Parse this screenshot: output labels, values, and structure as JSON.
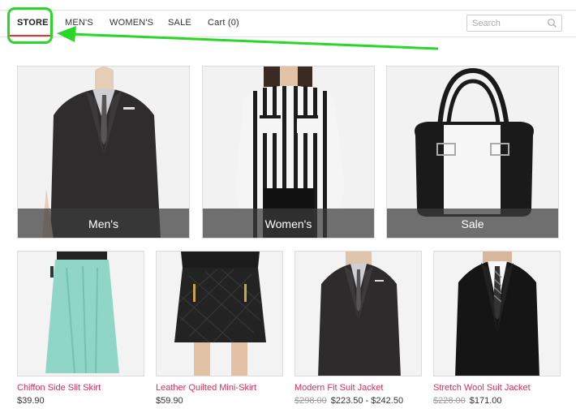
{
  "nav": {
    "items": [
      {
        "label": "STORE",
        "active": true
      },
      {
        "label": "MEN'S"
      },
      {
        "label": "WOMEN'S"
      },
      {
        "label": "SALE"
      },
      {
        "label": "Cart (0)"
      }
    ],
    "search_placeholder": "Search",
    "search_icon": "magnifier-icon"
  },
  "categories": [
    {
      "label": "Men's"
    },
    {
      "label": "Women's"
    },
    {
      "label": "Sale"
    }
  ],
  "products": [
    {
      "name": "Chiffon Side Slit Skirt",
      "price": "$39.90"
    },
    {
      "name": "Leather Quilted Mini-Skirt",
      "price": "$59.90"
    },
    {
      "name": "Modern Fit Suit Jacket",
      "old_price": "$298.00",
      "price": "$223.50 - $242.50"
    },
    {
      "name": "Stretch Wool Suit Jacket",
      "old_price": "$228.00",
      "price": "$171.00"
    }
  ],
  "colors": {
    "accent": "#e8333b",
    "link": "#e2275a",
    "annotation": "#2bd62b"
  }
}
